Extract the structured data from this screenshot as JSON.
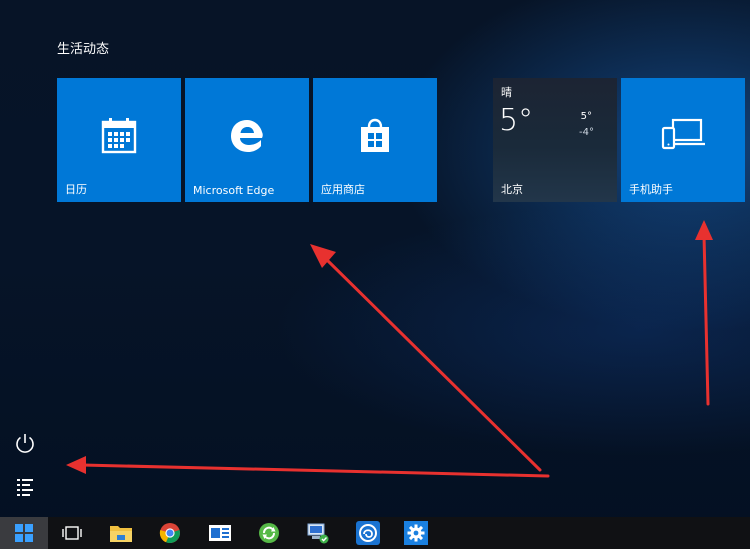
{
  "start_menu": {
    "group_title": "生活动态",
    "tiles": [
      {
        "label": "日历",
        "icon": "calendar-icon"
      },
      {
        "label": "Microsoft Edge",
        "icon": "edge-icon"
      },
      {
        "label": "应用商店",
        "icon": "store-icon"
      },
      {
        "label": "北京",
        "icon": "weather",
        "condition": "晴",
        "temp": "5°",
        "high": "5°",
        "low": "-4°"
      },
      {
        "label": "手机助手",
        "icon": "phone-companion-icon"
      }
    ],
    "side": [
      {
        "icon": "power-icon"
      },
      {
        "icon": "all-apps-list-icon"
      }
    ]
  },
  "taskbar": {
    "items": [
      {
        "icon": "windows-start-icon"
      },
      {
        "icon": "task-view-icon"
      },
      {
        "icon": "file-explorer-icon"
      },
      {
        "icon": "chrome-icon"
      },
      {
        "icon": "media-player-icon"
      },
      {
        "icon": "refresh-green-icon"
      },
      {
        "icon": "network-computer-icon"
      },
      {
        "icon": "app-circle-icon"
      },
      {
        "icon": "settings-gear-icon"
      }
    ]
  },
  "colors": {
    "tile_blue": "#0078d7",
    "taskbar_bg": "#101114",
    "arrow_red": "#e8312f"
  }
}
